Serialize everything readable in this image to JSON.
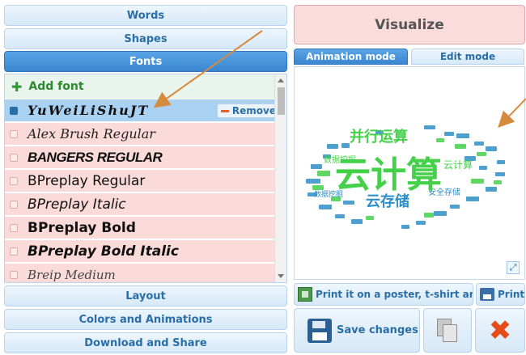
{
  "sidebar": {
    "words_label": "Words",
    "shapes_label": "Shapes",
    "fonts_label": "Fonts",
    "layout_label": "Layout",
    "colors_label": "Colors and Animations",
    "download_label": "Download and Share"
  },
  "fonts_panel": {
    "add_font_label": "Add font",
    "remove_label": "Remove",
    "items": [
      {
        "label": "YuWeiLiShuJT"
      },
      {
        "label": "Alex Brush Regular"
      },
      {
        "label": "BANGERS REGULAR"
      },
      {
        "label": "BPreplay Regular"
      },
      {
        "label": "BPreplay Italic"
      },
      {
        "label": "BPreplay Bold"
      },
      {
        "label": "BPreplay Bold Italic"
      },
      {
        "label": "Breip Medium"
      }
    ]
  },
  "main": {
    "visualize_label": "Visualize",
    "tabs": [
      {
        "label": "Animation mode"
      },
      {
        "label": "Edit mode"
      }
    ],
    "print_poster_label": "Print it on a poster, t-shirt and mo",
    "print_label": "Print",
    "save_label": "Save changes"
  },
  "colors": {
    "accent_blue": "#3a86d0",
    "row_pink": "#fbdada",
    "selected_blue": "#a9d1f2",
    "add_green": "#2f8a2f",
    "cloud_green": "#45d04a",
    "cloud_blue": "#2f8fc8",
    "arrow_orange": "#d68a3e",
    "delete_red": "#e44c1a"
  },
  "icons": [
    "plus-icon",
    "minus-icon",
    "expand-icon",
    "poster-icon",
    "printer-icon",
    "floppy-icon",
    "copy-icon",
    "delete-icon",
    "annotation-arrow"
  ]
}
